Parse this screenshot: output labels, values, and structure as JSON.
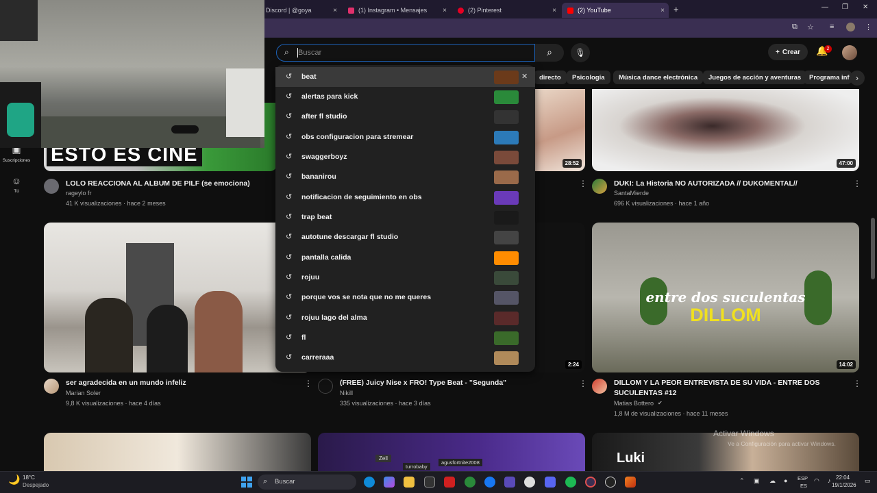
{
  "browser": {
    "tabs": [
      {
        "title": "Discord | @goya",
        "color": "#5865f2"
      },
      {
        "title": "(1) Instagram • Mensajes",
        "color": "#e1306c"
      },
      {
        "title": "(2) Pinterest",
        "color": "#e60023"
      },
      {
        "title": "(2) YouTube",
        "color": "#ff0000"
      }
    ],
    "new_tab": "+",
    "close": "×"
  },
  "youtube": {
    "search": {
      "placeholder": "Buscar"
    },
    "create_label": "Crear",
    "notification_count": "2",
    "chips": [
      "directo",
      "Psicología",
      "Música dance electrónica",
      "Juegos de acción y aventuras",
      "Programa info"
    ],
    "sidebar": [
      {
        "label": "Suscripciones",
        "icon": "subscriptions-icon"
      },
      {
        "label": "Tú",
        "icon": "account-icon"
      }
    ],
    "suggestions": [
      {
        "text": "beat",
        "thumb": "#6b3a1a"
      },
      {
        "text": "alertas para kick",
        "thumb": "#2a8a3a"
      },
      {
        "text": "after fl studio",
        "thumb": "#333333"
      },
      {
        "text": "obs configuracion para stremear",
        "thumb": "#2c7ab8"
      },
      {
        "text": "swaggerboyz",
        "thumb": "#7a4a3a"
      },
      {
        "text": "bananirou",
        "thumb": "#9a6a4a"
      },
      {
        "text": "notificacion de seguimiento en obs",
        "thumb": "#6a3ab8"
      },
      {
        "text": "trap beat",
        "thumb": "#1a1a1a"
      },
      {
        "text": "autotune descargar fl studio",
        "thumb": "#444444"
      },
      {
        "text": "pantalla calida",
        "thumb": "#ff8c00"
      },
      {
        "text": "rojuu",
        "thumb": "#3a4a3a"
      },
      {
        "text": "porque vos se nota que no me queres",
        "thumb": "#555566"
      },
      {
        "text": "rojuu lago del alma",
        "thumb": "#5a2a2a"
      },
      {
        "text": "fl",
        "thumb": "#3a6a2a"
      },
      {
        "text": "carreraaa",
        "thumb": "#b08a5a"
      }
    ],
    "videos": [
      {
        "title": "LOLO REACCIONA AL ALBUM DE PILF (se emociona)",
        "channel": "rageylo fr",
        "meta": "41 K visualizaciones · hace 2 meses",
        "thumb_text": "ESTO ES CINE"
      },
      {
        "title": "DUKI: La Historia NO AUTORIZADA // DUKOMENTAL//",
        "channel": "SantaMierde",
        "meta": "696 K visualizaciones · hace 1 año",
        "duration": "47:00"
      },
      {
        "title": "ser agradecida en un mundo infeliz",
        "channel": "Marian Soler",
        "meta": "9,8 K visualizaciones · hace 4 días"
      },
      {
        "title": "(FREE) Juicy Nise x FRO! Type Beat - \"Segunda\"",
        "channel": "Nikill",
        "meta": "335 visualizaciones · hace 3 días",
        "duration": "2:24"
      },
      {
        "title": "DILLOM Y LA PEOR ENTREVISTA DE SU VIDA - ENTRE DOS",
        "title2": "SUCULENTAS #12",
        "channel": "Matias Bottero",
        "meta": "1,8 M de visualizaciones · hace 11 meses",
        "duration": "14:02",
        "thumb_line1": "entre dos suculentas",
        "thumb_line2": "DILLOM"
      },
      {
        "duration": "28:52"
      }
    ],
    "bottom_thumbs": [
      "Zell",
      "turrobaby",
      "agusfortnite2008",
      "Luki"
    ]
  },
  "watermark": {
    "line1": "Activar Windows",
    "line2": "Ve a Configuración para activar Windows."
  },
  "taskbar": {
    "weather_temp": "18°C",
    "weather_desc": "Despejado",
    "search_label": "Buscar",
    "lang1": "ESP",
    "lang2": "ES",
    "time": "22:04",
    "date": "19/1/2026"
  }
}
